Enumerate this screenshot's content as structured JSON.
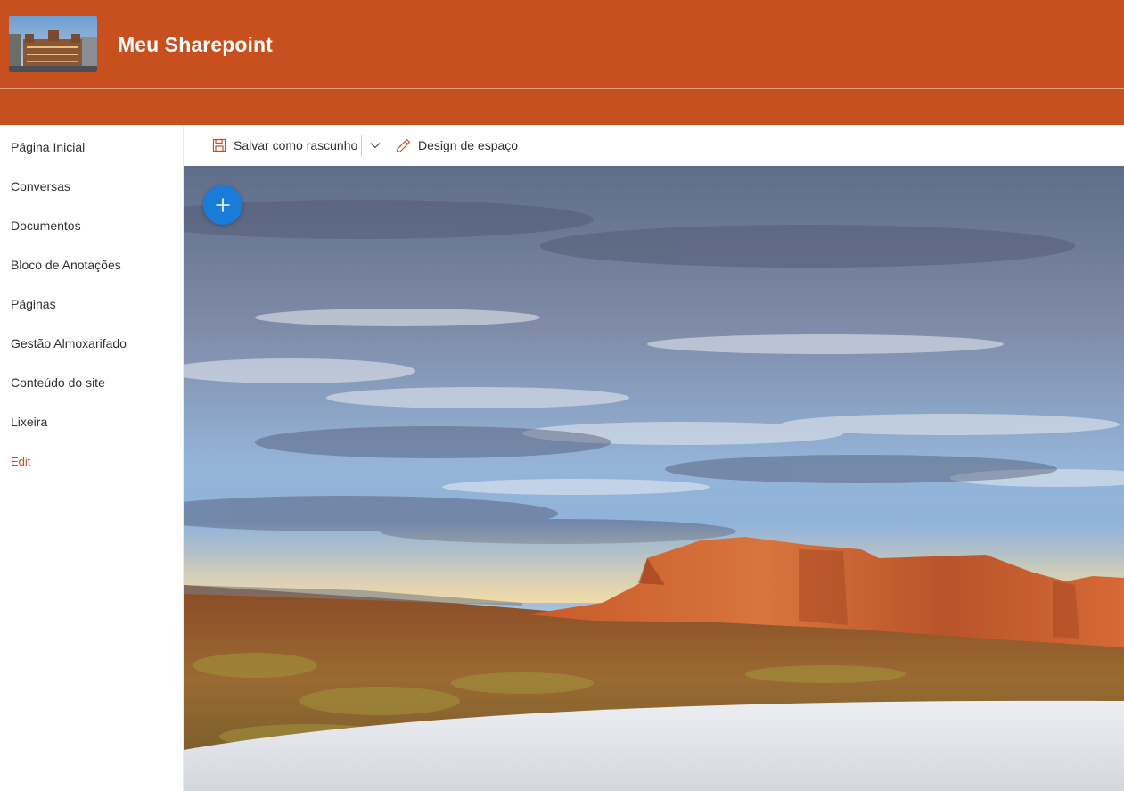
{
  "site": {
    "title": "Meu Sharepoint"
  },
  "nav": {
    "items": [
      {
        "label": "Página Inicial"
      },
      {
        "label": "Conversas"
      },
      {
        "label": "Documentos"
      },
      {
        "label": "Bloco de Anotações"
      },
      {
        "label": "Páginas"
      },
      {
        "label": "Gestão Almoxarifado"
      },
      {
        "label": "Conteúdo do site"
      },
      {
        "label": "Lixeira"
      }
    ],
    "edit_label": "Edit"
  },
  "commands": {
    "save_draft_label": "Salvar como rascunho",
    "space_design_label": "Design de espaço"
  },
  "icons": {
    "save": "save-icon",
    "dropdown": "chevron-down-icon",
    "design": "pencil-icon",
    "add": "plus-icon"
  },
  "colors": {
    "header": "#c84f1e",
    "accent_blue": "#1a7cd9",
    "edit_link": "#c84f1e"
  }
}
